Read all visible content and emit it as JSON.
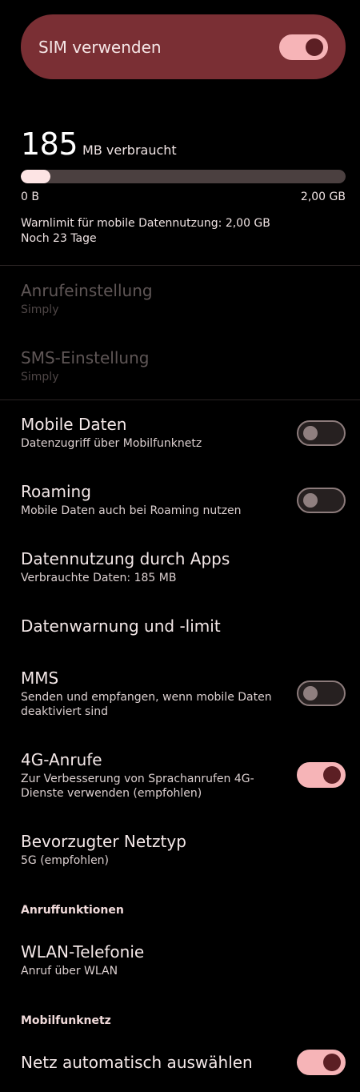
{
  "sim": {
    "label": "SIM verwenden",
    "enabled": true
  },
  "usage": {
    "number": "185",
    "unit": "MB verbraucht",
    "scale_min": "0 B",
    "scale_max": "2,00 GB",
    "fraction": 0.09,
    "warning": "Warnlimit für mobile Datennutzung: 2,00 GB",
    "remaining": "Noch 23 Tage"
  },
  "calls": {
    "title": "Anrufeinstellung",
    "sub": "Simply"
  },
  "sms": {
    "title": "SMS-Einstellung",
    "sub": "Simply"
  },
  "mobile_data": {
    "title": "Mobile Daten",
    "sub": "Datenzugriff über Mobilfunknetz",
    "on": false
  },
  "roaming": {
    "title": "Roaming",
    "sub": "Mobile Daten auch bei Roaming nutzen",
    "on": false
  },
  "app_usage": {
    "title": "Datennutzung durch Apps",
    "sub": "Verbrauchte Daten: 185 MB"
  },
  "data_warning": {
    "title": "Datenwarnung und -limit"
  },
  "mms": {
    "title": "MMS",
    "sub": "Senden und empfangen, wenn mobile Daten deaktiviert sind",
    "on": false
  },
  "lte_calls": {
    "title": "4G-Anrufe",
    "sub": "Zur Verbesserung von Sprachanrufen 4G-Dienste verwenden (empfohlen)",
    "on": true
  },
  "network_type": {
    "title": "Bevorzugter Netztyp",
    "sub": "5G (empfohlen)"
  },
  "section_calls": "Anruffunktionen",
  "wifi_calling": {
    "title": "WLAN-Telefonie",
    "sub": "Anruf über WLAN"
  },
  "section_network": "Mobilfunknetz",
  "auto_network": {
    "title": "Netz automatisch auswählen",
    "on": true
  }
}
